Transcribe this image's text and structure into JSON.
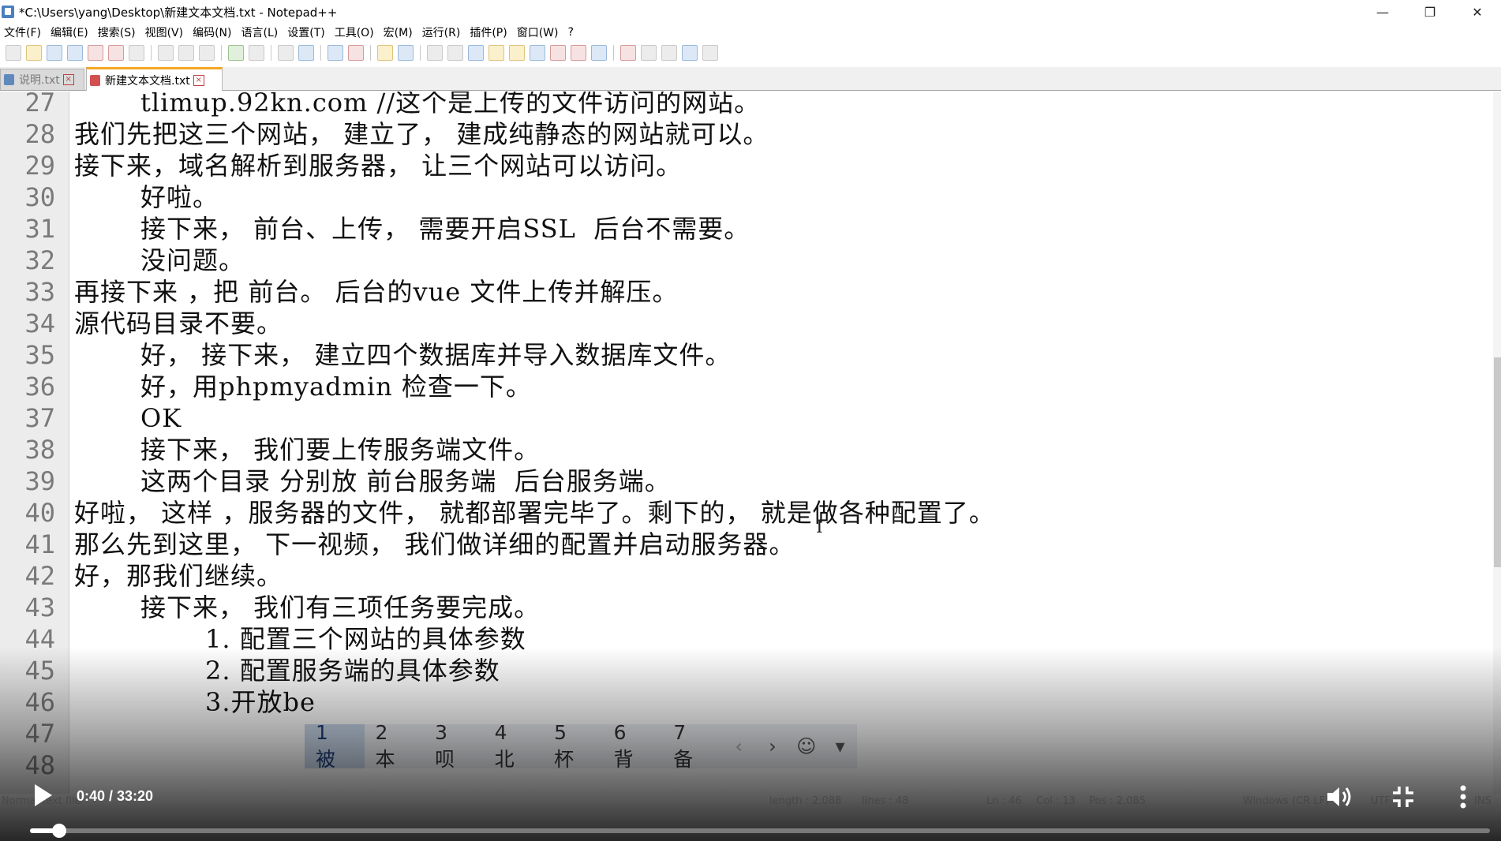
{
  "window": {
    "title": "*C:\\Users\\yang\\Desktop\\新建文本文档.txt - Notepad++",
    "minimize": "—",
    "restore": "❐",
    "close": "✕"
  },
  "menu": [
    "文件(F)",
    "编辑(E)",
    "搜索(S)",
    "视图(V)",
    "编码(N)",
    "语言(L)",
    "设置(T)",
    "工具(O)",
    "宏(M)",
    "运行(R)",
    "插件(P)",
    "窗口(W)",
    "?"
  ],
  "tabs": [
    {
      "label": "说明.txt",
      "close": "×"
    },
    {
      "label": "新建文本文档.txt",
      "close": "×"
    }
  ],
  "lines": [
    {
      "n": "27",
      "indent": 1,
      "text": "tlimup.92kn.com //这个是上传的文件访问的网站。"
    },
    {
      "n": "28",
      "indent": 0,
      "text": "我们先把这三个网站， 建立了， 建成纯静态的网站就可以。"
    },
    {
      "n": "29",
      "indent": 0,
      "text": "接下来，域名解析到服务器， 让三个网站可以访问。"
    },
    {
      "n": "30",
      "indent": 1,
      "text": "好啦。"
    },
    {
      "n": "31",
      "indent": 1,
      "text": "接下来， 前台、上传， 需要开启SSL  后台不需要。"
    },
    {
      "n": "32",
      "indent": 1,
      "text": "没问题。"
    },
    {
      "n": "33",
      "indent": 0,
      "text": "再接下来 ，把 前台。 后台的vue 文件上传并解压。"
    },
    {
      "n": "34",
      "indent": 0,
      "text": "源代码目录不要。"
    },
    {
      "n": "35",
      "indent": 1,
      "text": "好， 接下来， 建立四个数据库并导入数据库文件。"
    },
    {
      "n": "36",
      "indent": 1,
      "text": "好，用phpmyadmin 检查一下。"
    },
    {
      "n": "37",
      "indent": 1,
      "text": "OK"
    },
    {
      "n": "38",
      "indent": 1,
      "text": "接下来， 我们要上传服务端文件。"
    },
    {
      "n": "39",
      "indent": 1,
      "text": "这两个目录 分别放 前台服务端  后台服务端。"
    },
    {
      "n": "40",
      "indent": 0,
      "text": "好啦， 这样 ，服务器的文件， 就都部署完毕了。剩下的， 就是做各种配置了。"
    },
    {
      "n": "41",
      "indent": 0,
      "text": "那么先到这里， 下一视频， 我们做详细的配置并启动服务器。"
    },
    {
      "n": "42",
      "indent": 0,
      "text": "好，那我们继续。"
    },
    {
      "n": "43",
      "indent": 1,
      "text": "接下来， 我们有三项任务要完成。"
    },
    {
      "n": "44",
      "indent": 2,
      "text": "1. 配置三个网站的具体参数"
    },
    {
      "n": "45",
      "indent": 2,
      "text": "2. 配置服务端的具体参数"
    },
    {
      "n": "46",
      "indent": 2,
      "text": "3.开放be"
    },
    {
      "n": "47",
      "indent": 0,
      "text": ""
    },
    {
      "n": "48",
      "indent": 0,
      "text": ""
    }
  ],
  "ime": {
    "candidates": [
      "1 被",
      "2 本",
      "3 呗",
      "4 北",
      "5 杯",
      "6 背",
      "7 备"
    ],
    "prev": "‹",
    "next": "›",
    "emoji": "☺",
    "more": "▾"
  },
  "statusbar": {
    "mode": "Normal text file",
    "length": "length : 2,088",
    "lines": "lines : 48",
    "ln": "Ln : 46",
    "col": "Col : 13",
    "pos": "Pos : 2,085",
    "eol": "Windows (CR LF)",
    "encoding": "UTF-8",
    "ins": "INS"
  },
  "player": {
    "time": "0:40 / 33:20",
    "progress_fraction": 0.02,
    "volume_icon": "speaker-icon",
    "fullscreen_icon": "exit-fullscreen-icon",
    "more_icon": "more-vertical-icon"
  }
}
